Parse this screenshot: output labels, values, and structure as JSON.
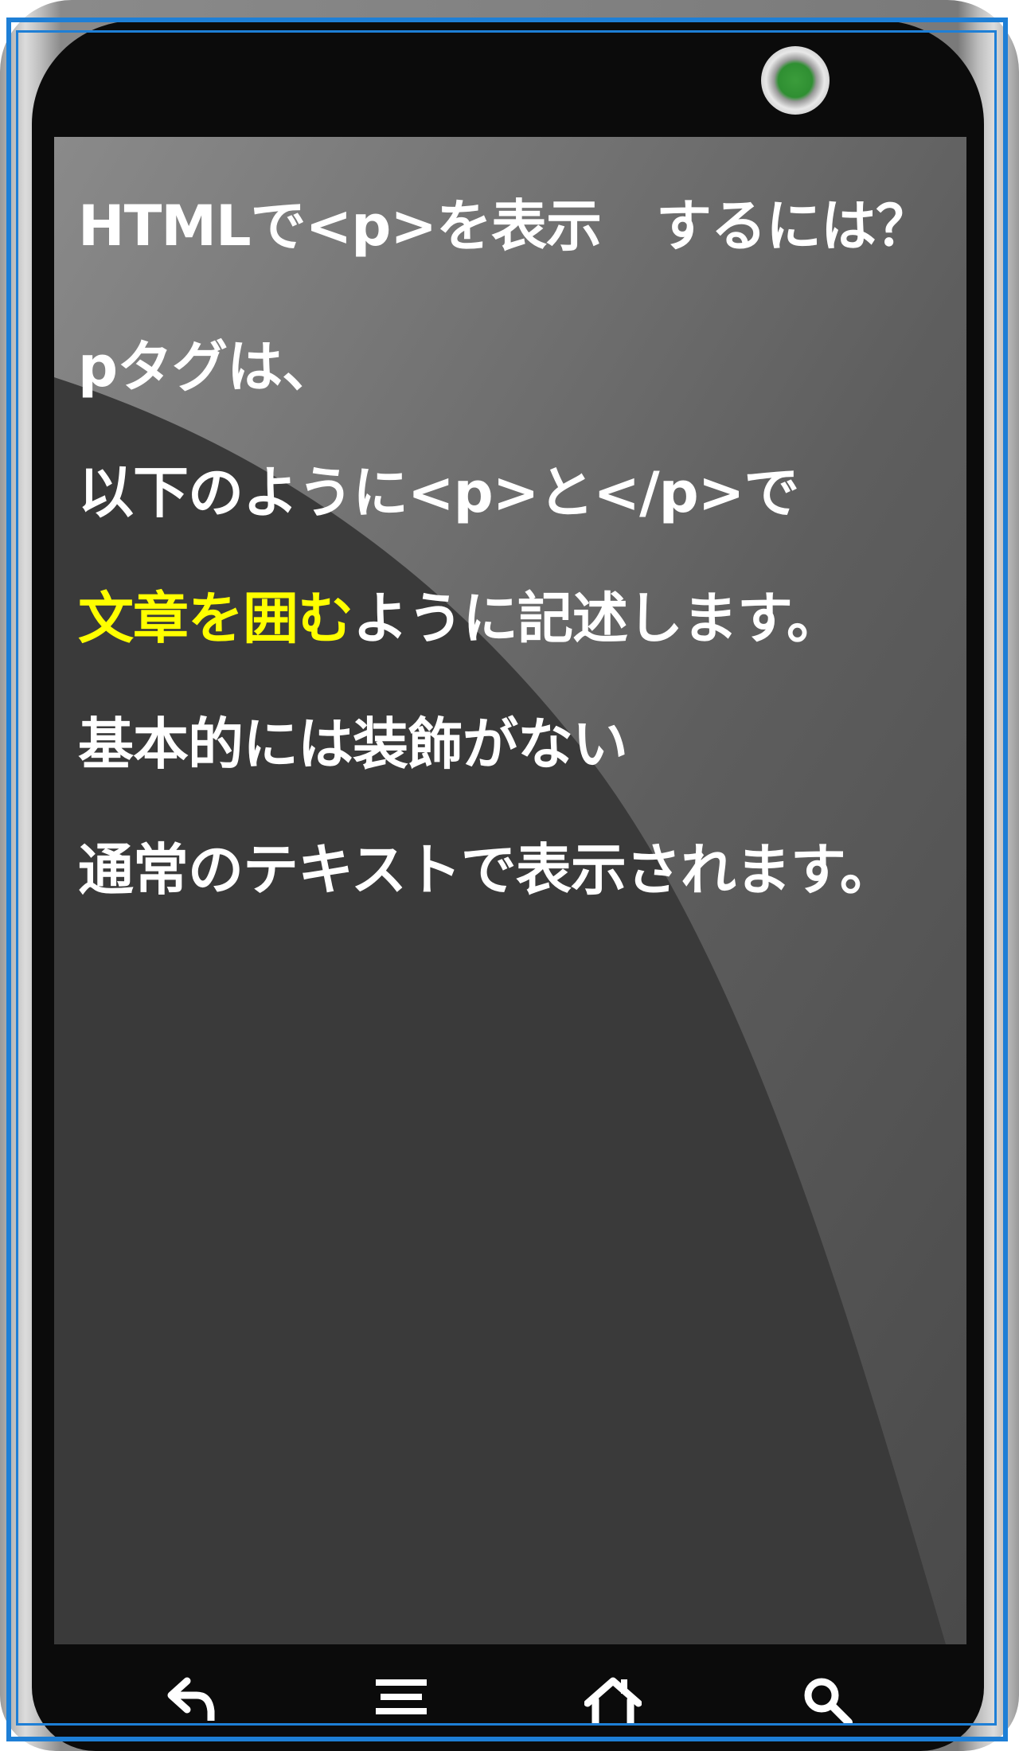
{
  "content": {
    "line1": "HTMLで<p>を表示　するには？",
    "line2": "pタグは、",
    "line3": "以下のように<p>と</p>で",
    "line4_highlight": "文章を囲む",
    "line4_rest": "ように記述します。",
    "line5": "基本的には装飾がない",
    "line6": "通常のテキストで表示されます。"
  },
  "colors": {
    "highlight": "#ffff00",
    "text": "#ffffff",
    "indicator": "#2f8f32"
  },
  "navbar": {
    "icons": [
      "back-icon",
      "menu-icon",
      "home-icon",
      "search-icon"
    ]
  }
}
